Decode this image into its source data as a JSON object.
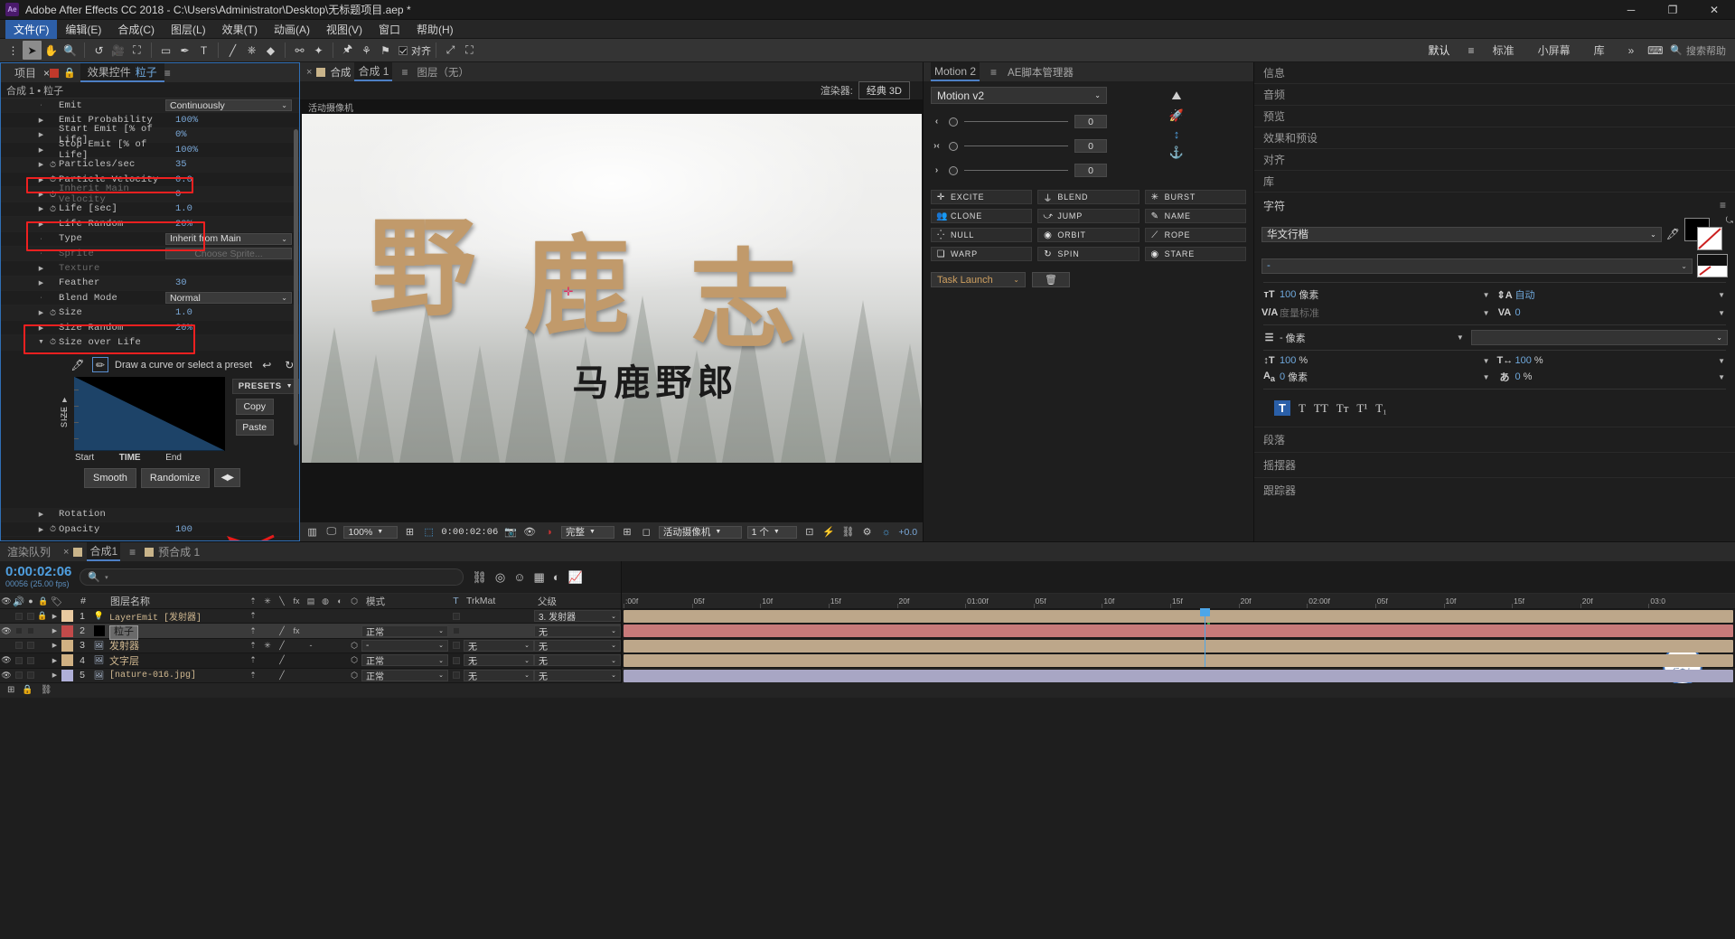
{
  "app": {
    "title": "Adobe After Effects CC 2018 - C:\\Users\\Administrator\\Desktop\\无标题项目.aep *",
    "logo": "Ae"
  },
  "window_controls": {
    "minimize": "─",
    "maximize": "❐",
    "close": "✕"
  },
  "menubar": [
    "文件(F)",
    "编辑(E)",
    "合成(C)",
    "图层(L)",
    "效果(T)",
    "动画(A)",
    "视图(V)",
    "窗口",
    "帮助(H)"
  ],
  "toolbar": {
    "snap_label": "对齐",
    "workspaces": [
      "默认",
      "标准",
      "小屏幕",
      "库"
    ],
    "overflow": "»",
    "search_placeholder": "搜索帮助"
  },
  "effect_controls": {
    "tabs": [
      {
        "label": "项目",
        "closable": false
      },
      {
        "label": "效果控件",
        "highlight": "粒子",
        "closable": true
      }
    ],
    "subtitle": "合成 1 • 粒子",
    "rows": [
      {
        "label": "Emit",
        "value": "Continuously",
        "kind": "dropdown",
        "arrow": false,
        "stopwatch": false
      },
      {
        "label": "Emit Probability",
        "value": "100%",
        "kind": "value",
        "arrow": true,
        "stopwatch": false
      },
      {
        "label": "Start Emit [% of Life]",
        "value": "0%",
        "kind": "value",
        "arrow": true,
        "stopwatch": false
      },
      {
        "label": "Stop Emit [% of Life]",
        "value": "100%",
        "kind": "value",
        "arrow": true,
        "stopwatch": false
      },
      {
        "label": "Particles/sec",
        "value": "35",
        "kind": "value",
        "arrow": true,
        "stopwatch": true
      },
      {
        "label": "Particle Velocity",
        "value": "0.0",
        "kind": "value",
        "arrow": true,
        "stopwatch": true
      },
      {
        "label": "Inherit Main Velocity",
        "value": "0",
        "kind": "value",
        "arrow": true,
        "stopwatch": true,
        "dim": true
      },
      {
        "label": "Life [sec]",
        "value": "1.0",
        "kind": "value",
        "arrow": true,
        "stopwatch": true
      },
      {
        "label": "Life Random",
        "value": "20%",
        "kind": "value",
        "arrow": true,
        "stopwatch": false
      },
      {
        "label": "Type",
        "value": "Inherit from Main",
        "kind": "dropdown",
        "arrow": false,
        "stopwatch": false
      },
      {
        "label": "Sprite",
        "value": "Choose Sprite...",
        "kind": "dropdown-disabled",
        "arrow": false,
        "stopwatch": false,
        "dim": true
      },
      {
        "label": "Texture",
        "value": "",
        "kind": "value",
        "arrow": true,
        "stopwatch": false,
        "dim": true
      },
      {
        "label": "Feather",
        "value": "30",
        "kind": "value",
        "arrow": true,
        "stopwatch": false
      },
      {
        "label": "Blend Mode",
        "value": "Normal",
        "kind": "dropdown",
        "arrow": false,
        "stopwatch": false
      },
      {
        "label": "Size",
        "value": "1.0",
        "kind": "value",
        "arrow": true,
        "stopwatch": true
      },
      {
        "label": "Size Random",
        "value": "20%",
        "kind": "value",
        "arrow": true,
        "stopwatch": false
      },
      {
        "label": "Size over Life",
        "value": "",
        "kind": "value",
        "arrow": true,
        "expanded": true,
        "stopwatch": true
      }
    ],
    "curve": {
      "hint": "Draw a curve or select a preset",
      "axis_label": "SIZE",
      "x_start": "Start",
      "x_mid": "TIME",
      "x_end": "End",
      "presets_label": "PRESETS",
      "copy_label": "Copy",
      "paste_label": "Paste",
      "smooth_label": "Smooth",
      "randomize_label": "Randomize",
      "stepper_label": "◀▶"
    },
    "bottom_rows": [
      {
        "label": "Rotation",
        "value": "",
        "arrow": true,
        "stopwatch": false
      },
      {
        "label": "Opacity",
        "value": "100",
        "arrow": true,
        "stopwatch": true
      }
    ],
    "highlight_color": "#ee2020"
  },
  "composition": {
    "tabs": [
      {
        "label": "合成 1",
        "closable": true,
        "active": true
      },
      {
        "label": "图层（无）",
        "closable": false,
        "active": false
      }
    ],
    "renderer_label": "渲染器:",
    "renderer_value": "经典 3D",
    "comp_name": "活动摄像机",
    "overlay_label": "活动摄像机",
    "canvas_text": {
      "ch1": "野",
      "ch2": "鹿",
      "ch3": "志",
      "subtitle": "马鹿野郎"
    },
    "footer": {
      "zoom": "100%",
      "timecode": "0:00:02:06",
      "quality": "完整",
      "camera": "活动摄像机",
      "views": "1 个",
      "exposure": "+0.0"
    }
  },
  "motion_panel": {
    "tabs": [
      "Motion 2",
      "AE脚本管理器"
    ],
    "version_select": "Motion v2",
    "sliders": [
      {
        "icon": "‹",
        "value": "0"
      },
      {
        "icon": "›‹",
        "value": "0"
      },
      {
        "icon": "›",
        "value": "0"
      }
    ],
    "buttons": [
      {
        "label": "EXCITE",
        "icon": "✛"
      },
      {
        "label": "BLEND",
        "icon": "⏚"
      },
      {
        "label": "BURST",
        "icon": "✳"
      },
      {
        "label": "CLONE",
        "icon": "👥"
      },
      {
        "label": "JUMP",
        "icon": "⤻"
      },
      {
        "label": "NAME",
        "icon": "✎"
      },
      {
        "label": "NULL",
        "icon": "⁛"
      },
      {
        "label": "ORBIT",
        "icon": "◉"
      },
      {
        "label": "ROPE",
        "icon": "⟋"
      },
      {
        "label": "WARP",
        "icon": "❏"
      },
      {
        "label": "SPIN",
        "icon": "↻"
      },
      {
        "label": "STARE",
        "icon": "◉"
      }
    ],
    "task_launch": "Task Launch",
    "trash_icon": "🗑",
    "side_icons": [
      "mountain-icon",
      "rocket-icon",
      "updown-arrow-icon",
      "anchor-icon"
    ]
  },
  "right_sidebar": {
    "panels": [
      "信息",
      "音频",
      "预览",
      "效果和预设",
      "对齐",
      "库"
    ],
    "character": {
      "title": "字符",
      "font_family": "华文行楷",
      "font_style": "-",
      "font_size": {
        "value": "100",
        "unit": "像素"
      },
      "leading": {
        "value": "自动",
        "unit": ""
      },
      "kerning": {
        "value": "度量标准",
        "unit": ""
      },
      "tracking": {
        "value": "0",
        "unit": ""
      },
      "stroke_width": {
        "value": "-",
        "unit": "像素"
      },
      "vertical_scale": {
        "value": "100",
        "unit": "%"
      },
      "horizontal_scale": {
        "value": "100",
        "unit": "%"
      },
      "baseline_shift": {
        "value": "0",
        "unit": "像素"
      },
      "tsume": {
        "value": "0",
        "unit": "%"
      },
      "styles": [
        "T",
        "T",
        "TT",
        "Tт",
        "T¹",
        "T₁"
      ]
    },
    "paragraph_title": "段落",
    "wiggler_title": "摇摆器",
    "tracker_title": "跟踪器"
  },
  "timeline": {
    "tabs": [
      {
        "label": "渲染队列",
        "closable": false,
        "active": false
      },
      {
        "label": "合成1",
        "closable": true,
        "active": true
      },
      {
        "label": "预合成 1",
        "closable": false,
        "active": false
      }
    ],
    "timecode": "0:00:02:06",
    "frame_info": "00056 (25.00 fps)",
    "search_placeholder": "",
    "columns": {
      "num": "#",
      "name": "图层名称",
      "mode": "模式",
      "t": "T",
      "trkmat": "TrkMat",
      "parent": "父级"
    },
    "layers": [
      {
        "num": "1",
        "name": "LayerEmit [发射器]",
        "mono": true,
        "color": "#e8c9a0",
        "eye": false,
        "lock": true,
        "mode": "",
        "trkmat": "",
        "parent": "3. 发射器",
        "bar_color": "#bda78a",
        "selected": false,
        "icon": "bulb"
      },
      {
        "num": "2",
        "name": "粒子",
        "mono": false,
        "color": "#c24a4a",
        "eye": true,
        "lock": false,
        "mode": "正常",
        "trkmat": "",
        "parent": "无",
        "bar_color": "#c87a7a",
        "selected": true,
        "editing": true,
        "icon": "solid"
      },
      {
        "num": "3",
        "name": "发射器",
        "mono": false,
        "color": "#d0b183",
        "eye": false,
        "lock": false,
        "mode": "-",
        "trkmat": "无",
        "parent": "无",
        "bar_color": "#bda78a",
        "selected": false,
        "icon": "image"
      },
      {
        "num": "4",
        "name": "文字层",
        "mono": false,
        "color": "#d0b183",
        "eye": true,
        "lock": false,
        "mode": "正常",
        "trkmat": "无",
        "parent": "无",
        "bar_color": "#bda78a",
        "selected": false,
        "icon": "image"
      },
      {
        "num": "5",
        "name": "[nature-016.jpg]",
        "mono": true,
        "color": "#b0b0d8",
        "eye": true,
        "lock": false,
        "mode": "正常",
        "trkmat": "无",
        "parent": "无",
        "bar_color": "#a8a6c4",
        "selected": false,
        "icon": "image"
      }
    ],
    "ruler_ticks": [
      ":00f",
      "05f",
      "10f",
      "15f",
      "20f",
      "01:00f",
      "05f",
      "10f",
      "15f",
      "20f",
      "02:00f",
      "05f",
      "10f",
      "15f",
      "20f",
      "03:0"
    ],
    "watermark": "行走大"
  }
}
